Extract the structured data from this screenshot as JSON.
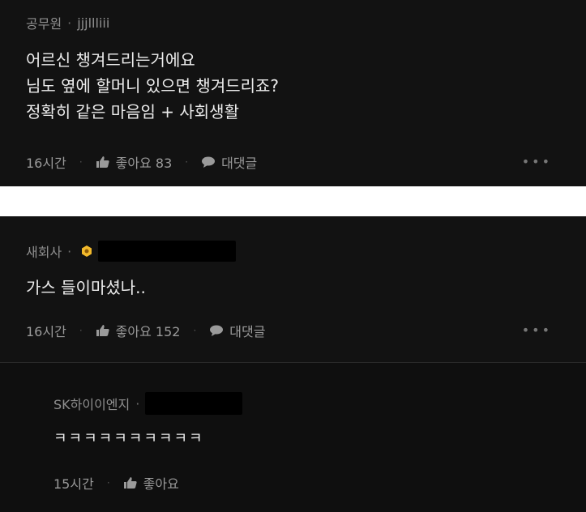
{
  "comments": [
    {
      "author": "공무원",
      "nickname": "jjjllliii",
      "lines": [
        "어르신 챙겨드리는거에요",
        "님도 옆에 할머니 있으면 챙겨드리죠?",
        "정확히 같은 마음임 + 사회생활"
      ],
      "time": "16시간",
      "like_label": "좋아요 83",
      "reply_label": "대댓글",
      "more": "•••"
    },
    {
      "author": "새회사",
      "lines": [
        "가스 들이마셨나.."
      ],
      "time": "16시간",
      "like_label": "좋아요 152",
      "reply_label": "대댓글",
      "more": "•••"
    },
    {
      "author": "SK하이이엔지",
      "lines": [
        "ㅋㅋㅋㅋㅋㅋㅋㅋㅋㅋ"
      ],
      "time": "15시간",
      "like_label": "좋아요"
    }
  ],
  "icons": {
    "like": "thumbs-up-icon",
    "reply": "speech-bubble-icon",
    "badge": "hexagon-badge-icon"
  },
  "colors": {
    "background": "#121212",
    "divider": "#ffffff",
    "badge": "#f2b92b"
  }
}
